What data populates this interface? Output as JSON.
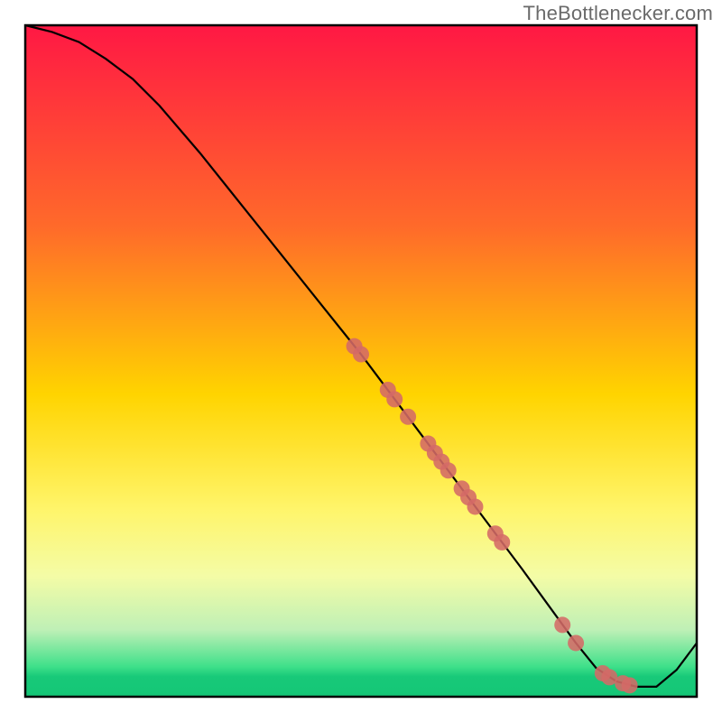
{
  "watermark": "TheBottlenecker.com",
  "chart_data": {
    "type": "line",
    "title": "",
    "xlabel": "",
    "ylabel": "",
    "xlim": [
      0,
      100
    ],
    "ylim": [
      0,
      100
    ],
    "background": {
      "type": "vertical-gradient",
      "stops": [
        {
          "offset": 0.0,
          "color": "#ff1844"
        },
        {
          "offset": 0.3,
          "color": "#ff6a2a"
        },
        {
          "offset": 0.55,
          "color": "#ffd400"
        },
        {
          "offset": 0.72,
          "color": "#fff56a"
        },
        {
          "offset": 0.82,
          "color": "#f4fca6"
        },
        {
          "offset": 0.9,
          "color": "#bff0b6"
        },
        {
          "offset": 0.955,
          "color": "#3fe08a"
        },
        {
          "offset": 0.97,
          "color": "#18c979"
        },
        {
          "offset": 1.0,
          "color": "#14c676"
        }
      ]
    },
    "series": [
      {
        "name": "bottleneck-curve",
        "color": "#000000",
        "x": [
          0,
          4,
          8,
          12,
          16,
          20,
          26,
          32,
          38,
          44,
          50,
          56,
          62,
          68,
          74,
          78,
          82,
          85,
          88,
          91,
          94,
          97,
          100
        ],
        "y": [
          100,
          99,
          97.5,
          95,
          92,
          88,
          81,
          73.5,
          66,
          58.5,
          51,
          43,
          35,
          27,
          19,
          13.5,
          8,
          4.3,
          2.3,
          1.5,
          1.5,
          4,
          8
        ]
      }
    ],
    "scatter": [
      {
        "name": "points-on-curve",
        "color": "#d46a66",
        "radius_px": 9,
        "x": [
          49,
          50,
          54,
          55,
          57,
          60,
          61,
          62,
          63,
          65,
          66,
          67,
          70,
          71,
          80,
          82,
          86,
          87,
          89,
          90
        ],
        "y": [
          52.2,
          51.0,
          45.7,
          44.3,
          41.7,
          37.7,
          36.3,
          35.0,
          33.7,
          31.0,
          29.7,
          28.3,
          24.3,
          23.0,
          10.7,
          8.0,
          3.5,
          2.9,
          2.0,
          1.7
        ]
      }
    ]
  }
}
